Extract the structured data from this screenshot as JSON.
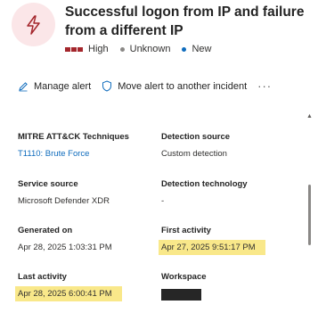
{
  "alert": {
    "title": "Successful logon from IP and failure from a different IP",
    "severity": "High",
    "status_unknown": "Unknown",
    "status_new": "New",
    "icon": "lightning-icon",
    "colors": {
      "severity": "#a4262c",
      "unknown_dot": "#8a8886",
      "new_dot": "#0f6cbd",
      "badge_bg": "#fbe6e8",
      "highlight": "#f9e88a",
      "link": "#0f6cbd"
    }
  },
  "actions": {
    "manage": "Manage alert",
    "move": "Move alert to another incident",
    "more": "···"
  },
  "details": {
    "mitre_label": "MITRE ATT&CK Techniques",
    "mitre_value": "T1110: Brute Force",
    "detection_source_label": "Detection source",
    "detection_source_value": "Custom detection",
    "service_source_label": "Service source",
    "service_source_value": "Microsoft Defender XDR",
    "detection_tech_label": "Detection technology",
    "detection_tech_value": "-",
    "generated_label": "Generated on",
    "generated_value": "Apr 28, 2025 1:03:31 PM",
    "first_activity_label": "First activity",
    "first_activity_value": "Apr 27, 2025 9:51:17 PM",
    "last_activity_label": "Last activity",
    "last_activity_value": "Apr 28, 2025 6:00:41 PM",
    "workspace_label": "Workspace"
  }
}
